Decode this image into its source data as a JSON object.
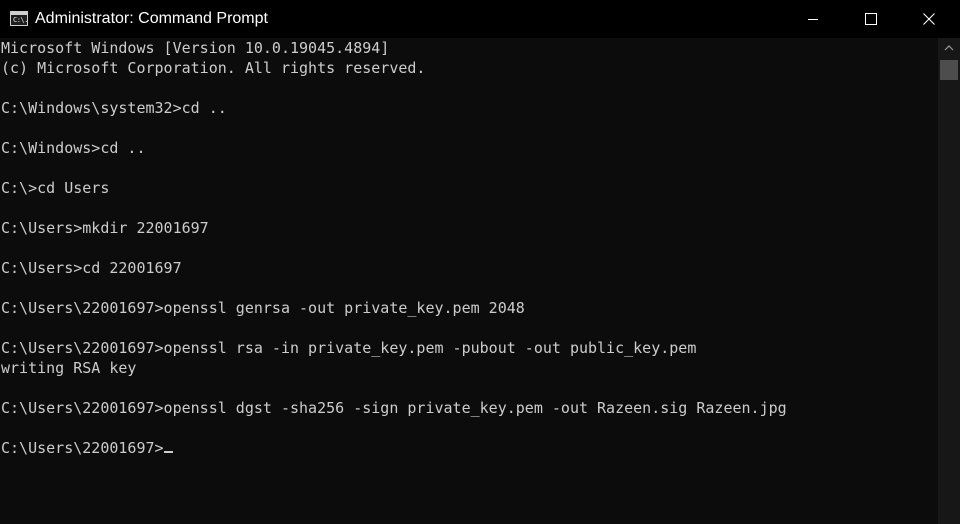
{
  "window": {
    "title": "Administrator: Command Prompt",
    "app_icon_glyph": "C:\\."
  },
  "console": {
    "lines": [
      "Microsoft Windows [Version 10.0.19045.4894]",
      "(c) Microsoft Corporation. All rights reserved.",
      "",
      "C:\\Windows\\system32>cd ..",
      "",
      "C:\\Windows>cd ..",
      "",
      "C:\\>cd Users",
      "",
      "C:\\Users>mkdir 22001697",
      "",
      "C:\\Users>cd 22001697",
      "",
      "C:\\Users\\22001697>openssl genrsa -out private_key.pem 2048",
      "",
      "C:\\Users\\22001697>openssl rsa -in private_key.pem -pubout -out public_key.pem",
      "writing RSA key",
      "",
      "C:\\Users\\22001697>openssl dgst -sha256 -sign private_key.pem -out Razeen.sig Razeen.jpg",
      "",
      "C:\\Users\\22001697>"
    ]
  },
  "icons": {
    "minimize": "minimize-icon",
    "maximize": "maximize-icon",
    "close": "close-icon",
    "scroll_up": "scroll-up-arrow-icon"
  },
  "colors": {
    "background": "#0c0c0c",
    "text": "#cccccc",
    "titlebar": "#000000"
  }
}
